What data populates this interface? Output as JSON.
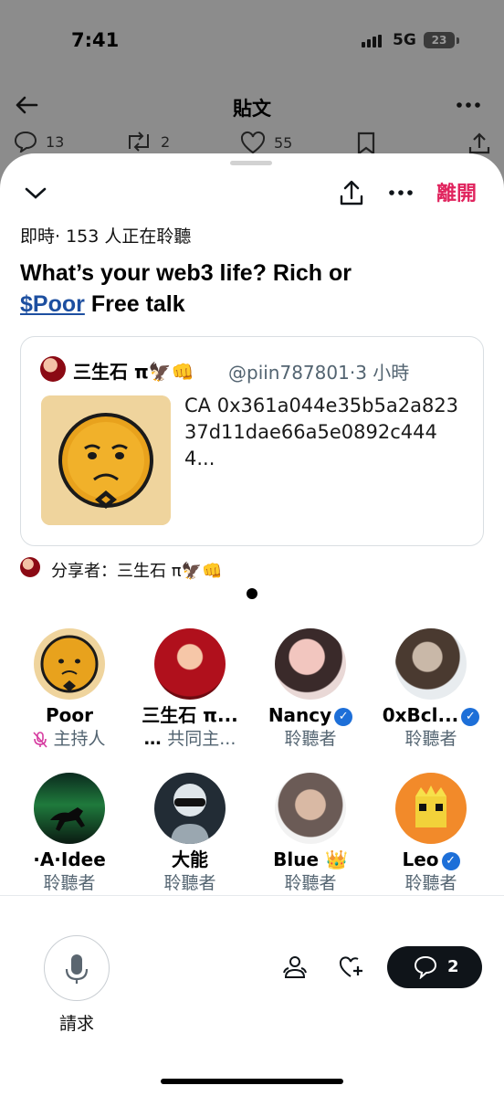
{
  "status": {
    "time": "7:41",
    "network": "5G",
    "battery": "23"
  },
  "post_header": {
    "title": "貼文"
  },
  "post_stats": {
    "replies": "13",
    "reposts": "2",
    "likes": "55"
  },
  "space": {
    "leave_label": "離開",
    "live_status": "即時· 153 人正在聆聽",
    "title_part1": "What’s your web3 life? Rich or",
    "cashtag": "$Poor",
    "title_part2": "Free talk"
  },
  "tweet_card": {
    "author_name": "三生石 π🦅👊",
    "handle_time": "@piin787801·3 小時",
    "text": "CA 0x361a044e35b5a2a82337d11dae66a5e0892c4444..."
  },
  "shared_by": "分享者：三生石 π🦅👊",
  "participants": [
    {
      "name": "Poor",
      "role": "主持人",
      "verified": false
    },
    {
      "name": "三生石 π...",
      "role": "共同主...",
      "verified": false
    },
    {
      "name": "Nancy",
      "role": "聆聽者",
      "verified": true
    },
    {
      "name": "0xBcl...",
      "role": "聆聽者",
      "verified": true
    },
    {
      "name": "·A·Idee",
      "role": "聆聽者",
      "verified": false
    },
    {
      "name": "大能",
      "role": "聆聽者",
      "verified": false
    },
    {
      "name": "Blue 👑",
      "role": "聆聽者",
      "verified": false
    },
    {
      "name": "Leo",
      "role": "聆聽者",
      "verified": true
    }
  ],
  "bottom": {
    "request_label": "請求",
    "chat_count": "2"
  },
  "colors": {
    "accent_red": "#e0245e",
    "verified_blue": "#1d6fd8",
    "link_blue": "#1d4fa0"
  }
}
